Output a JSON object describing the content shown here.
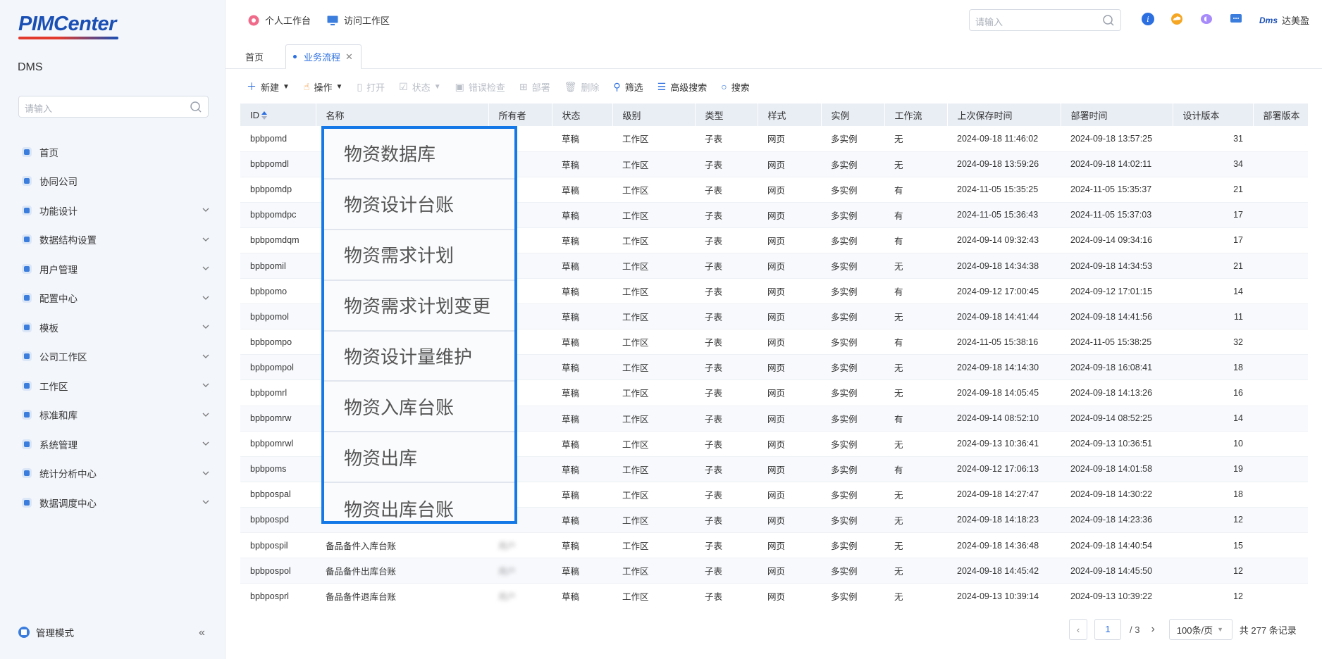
{
  "sidebar": {
    "logo": "PIMCenter",
    "app_name": "DMS",
    "search_placeholder": "请输入",
    "items": [
      {
        "label": "首页",
        "icon": "home-icon",
        "expandable": false
      },
      {
        "label": "协同公司",
        "icon": "building-icon",
        "expandable": false
      },
      {
        "label": "功能设计",
        "icon": "design-icon",
        "expandable": true
      },
      {
        "label": "数据结构设置",
        "icon": "cube-icon",
        "expandable": true
      },
      {
        "label": "用户管理",
        "icon": "user-icon",
        "expandable": true
      },
      {
        "label": "配置中心",
        "icon": "config-icon",
        "expandable": true
      },
      {
        "label": "模板",
        "icon": "template-icon",
        "expandable": true
      },
      {
        "label": "公司工作区",
        "icon": "company-workspace-icon",
        "expandable": true
      },
      {
        "label": "工作区",
        "icon": "workspace-icon",
        "expandable": true
      },
      {
        "label": "标准和库",
        "icon": "library-icon",
        "expandable": true
      },
      {
        "label": "系统管理",
        "icon": "system-icon",
        "expandable": true
      },
      {
        "label": "统计分析中心",
        "icon": "analytics-icon",
        "expandable": true
      },
      {
        "label": "数据调度中心",
        "icon": "schedule-icon",
        "expandable": true
      }
    ],
    "footer_label": "管理模式"
  },
  "topbar": {
    "personal_workbench": "个人工作台",
    "visit_workspace": "访问工作区",
    "search_placeholder": "请输入",
    "user_brand": "Dms",
    "user_name": "达美盈"
  },
  "tabs": [
    {
      "label": "首页"
    },
    {
      "label": "业务流程",
      "active": true
    }
  ],
  "toolbar": {
    "new": "新建",
    "operate": "操作",
    "open": "打开",
    "status": "状态",
    "error_check": "错误检查",
    "deploy": "部署",
    "delete": "删除",
    "filter": "筛选",
    "advanced_search": "高级搜索",
    "search": "搜索"
  },
  "table": {
    "columns": [
      "ID",
      "名称",
      "所有者",
      "状态",
      "级别",
      "类型",
      "样式",
      "实例",
      "工作流",
      "上次保存时间",
      "部署时间",
      "设计版本",
      "部署版本"
    ],
    "rows": [
      [
        "bpbpomd",
        "",
        "",
        "草稿",
        "工作区",
        "子表",
        "网页",
        "多实例",
        "无",
        "2024-09-18 11:46:02",
        "2024-09-18 13:57:25",
        "31"
      ],
      [
        "bpbpomdl",
        "",
        "",
        "草稿",
        "工作区",
        "子表",
        "网页",
        "多实例",
        "无",
        "2024-09-18 13:59:26",
        "2024-09-18 14:02:11",
        "34"
      ],
      [
        "bpbpomdp",
        "",
        "",
        "草稿",
        "工作区",
        "子表",
        "网页",
        "多实例",
        "有",
        "2024-11-05 15:35:25",
        "2024-11-05 15:35:37",
        "21"
      ],
      [
        "bpbpomdpc",
        "",
        "",
        "草稿",
        "工作区",
        "子表",
        "网页",
        "多实例",
        "有",
        "2024-11-05 15:36:43",
        "2024-11-05 15:37:03",
        "17"
      ],
      [
        "bpbpomdqm",
        "",
        "",
        "草稿",
        "工作区",
        "子表",
        "网页",
        "多实例",
        "有",
        "2024-09-14 09:32:43",
        "2024-09-14 09:34:16",
        "17"
      ],
      [
        "bpbpomil",
        "",
        "",
        "草稿",
        "工作区",
        "子表",
        "网页",
        "多实例",
        "无",
        "2024-09-18 14:34:38",
        "2024-09-18 14:34:53",
        "21"
      ],
      [
        "bpbpomo",
        "",
        "",
        "草稿",
        "工作区",
        "子表",
        "网页",
        "多实例",
        "有",
        "2024-09-12 17:00:45",
        "2024-09-12 17:01:15",
        "14"
      ],
      [
        "bpbpomol",
        "",
        "",
        "草稿",
        "工作区",
        "子表",
        "网页",
        "多实例",
        "无",
        "2024-09-18 14:41:44",
        "2024-09-18 14:41:56",
        "11"
      ],
      [
        "bpbpompo",
        "",
        "",
        "草稿",
        "工作区",
        "子表",
        "网页",
        "多实例",
        "有",
        "2024-11-05 15:38:16",
        "2024-11-05 15:38:25",
        "32"
      ],
      [
        "bpbpompol",
        "",
        "",
        "草稿",
        "工作区",
        "子表",
        "网页",
        "多实例",
        "无",
        "2024-09-18 14:14:30",
        "2024-09-18 16:08:41",
        "18"
      ],
      [
        "bpbpomrl",
        "",
        "",
        "草稿",
        "工作区",
        "子表",
        "网页",
        "多实例",
        "无",
        "2024-09-18 14:05:45",
        "2024-09-18 14:13:26",
        "16"
      ],
      [
        "bpbpomrw",
        "",
        "",
        "草稿",
        "工作区",
        "子表",
        "网页",
        "多实例",
        "有",
        "2024-09-14 08:52:10",
        "2024-09-14 08:52:25",
        "14"
      ],
      [
        "bpbpomrwl",
        "",
        "",
        "草稿",
        "工作区",
        "子表",
        "网页",
        "多实例",
        "无",
        "2024-09-13 10:36:41",
        "2024-09-13 10:36:51",
        "10"
      ],
      [
        "bpbpoms",
        "",
        "",
        "草稿",
        "工作区",
        "子表",
        "网页",
        "多实例",
        "有",
        "2024-09-12 17:06:13",
        "2024-09-18 14:01:58",
        "19"
      ],
      [
        "bpbpospal",
        "",
        "",
        "草稿",
        "工作区",
        "子表",
        "网页",
        "多实例",
        "无",
        "2024-09-18 14:27:47",
        "2024-09-18 14:30:22",
        "18"
      ],
      [
        "bpbpospd",
        "",
        "",
        "草稿",
        "工作区",
        "子表",
        "网页",
        "多实例",
        "无",
        "2024-09-18 14:18:23",
        "2024-09-18 14:23:36",
        "12"
      ],
      [
        "bpbpospil",
        "备品备件入库台账",
        "",
        "草稿",
        "工作区",
        "子表",
        "网页",
        "多实例",
        "无",
        "2024-09-18 14:36:48",
        "2024-09-18 14:40:54",
        "15"
      ],
      [
        "bpbpospol",
        "备品备件出库台账",
        "",
        "草稿",
        "工作区",
        "子表",
        "网页",
        "多实例",
        "无",
        "2024-09-18 14:45:42",
        "2024-09-18 14:45:50",
        "12"
      ],
      [
        "bpbposprl",
        "备品备件退库台账",
        "",
        "草稿",
        "工作区",
        "子表",
        "网页",
        "多实例",
        "无",
        "2024-09-13 10:39:14",
        "2024-09-13 10:39:22",
        "12"
      ]
    ]
  },
  "highlight_names": [
    "物资数据库",
    "物资设计台账",
    "物资需求计划",
    "物资需求计划变更",
    "物资设计量维护",
    "物资入库台账",
    "物资出库",
    "物资出库台账"
  ],
  "pagination": {
    "current_page": "1",
    "total_pages": "/ 3",
    "page_size": "100条/页",
    "total": "共 277 条记录"
  },
  "colors": {
    "accent": "#2c6fe0",
    "highlight_border": "#1478e6",
    "header_bg": "#e9eef5"
  }
}
